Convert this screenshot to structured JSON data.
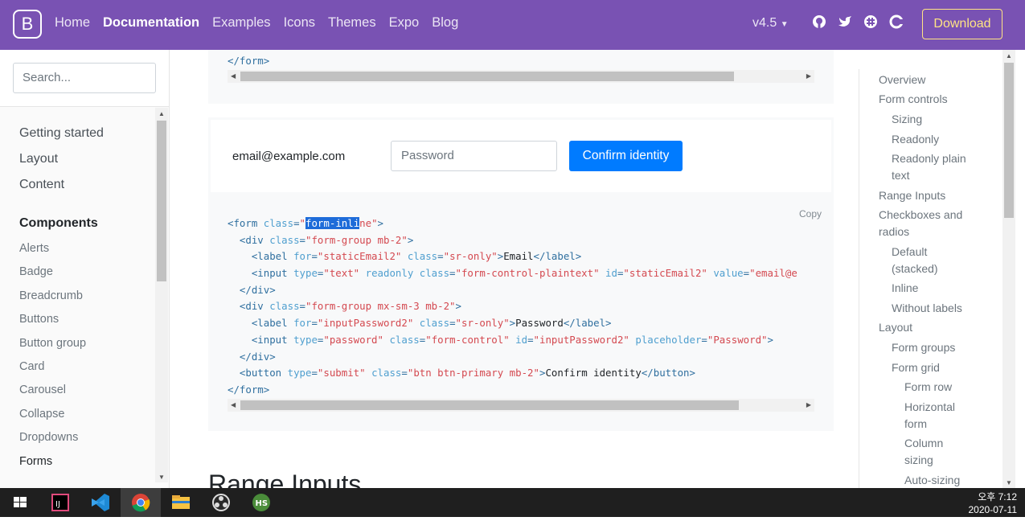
{
  "navbar": {
    "brand": "B",
    "links": [
      "Home",
      "Documentation",
      "Examples",
      "Icons",
      "Themes",
      "Expo",
      "Blog"
    ],
    "version": "v4.5",
    "download": "Download",
    "icons": [
      "github-icon",
      "twitter-icon",
      "slack-icon",
      "opencollective-icon"
    ]
  },
  "sidebar": {
    "search_placeholder": "Search...",
    "groups": [
      "Getting started",
      "Layout",
      "Content"
    ],
    "components_label": "Components",
    "items": [
      "Alerts",
      "Badge",
      "Breadcrumb",
      "Buttons",
      "Button group",
      "Card",
      "Carousel",
      "Collapse",
      "Dropdowns",
      "Forms"
    ]
  },
  "main": {
    "top_code_line": "</form>",
    "example": {
      "static_email": "email@example.com",
      "password_placeholder": "Password",
      "confirm_label": "Confirm identity"
    },
    "copy_label": "Copy",
    "section_heading": "Range Inputs"
  },
  "toc": {
    "items": [
      "Overview",
      "Form controls",
      "Sizing",
      "Readonly",
      "Readonly plain text",
      "Range Inputs",
      "Checkboxes and radios",
      "Default (stacked)",
      "Inline",
      "Without labels",
      "Layout",
      "Form groups",
      "Form grid",
      "Form row",
      "Horizontal form",
      "Column sizing",
      "Auto-sizing"
    ]
  },
  "taskbar": {
    "time": "오후 7:12",
    "date": "2020-07-11"
  },
  "colors": {
    "navbar": "#7952b3",
    "download": "#ffe484",
    "primary": "#007bff"
  }
}
